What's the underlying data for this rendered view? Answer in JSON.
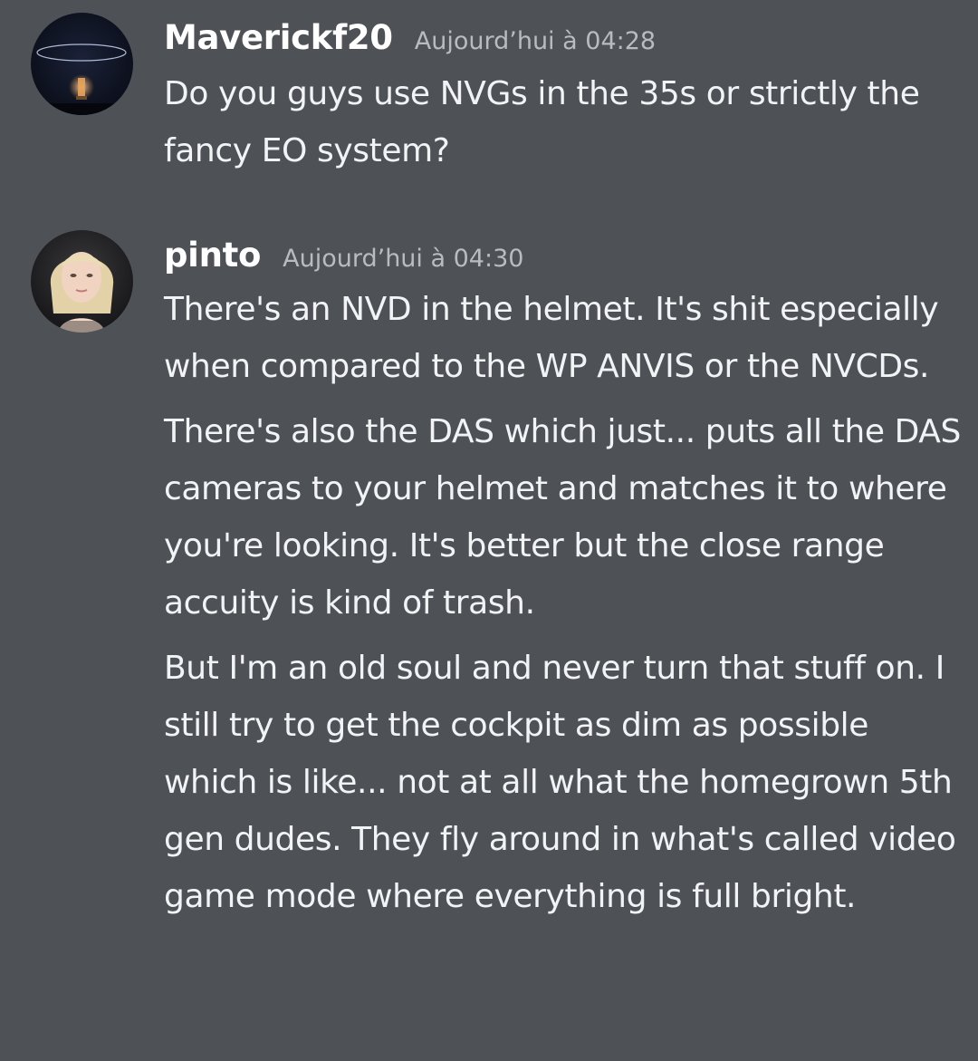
{
  "messages": [
    {
      "username": "Maverickf20",
      "timestamp": "Aujourd’hui à 04:28",
      "paragraphs": [
        "Do you guys use NVGs in the 35s or strictly the fancy EO system?"
      ]
    },
    {
      "username": "pinto",
      "timestamp": "Aujourd’hui à 04:30",
      "paragraphs": [
        "There's an NVD in the helmet. It's shit especially when compared to the WP ANVIS or the NVCDs.",
        "There's also the DAS which just... puts all the DAS cameras to your helmet and matches it to where you're looking. It's better but the close range accuity is kind of trash.",
        "But I'm an old soul and never turn that stuff on. I still try to get the cockpit as dim as possible which is like... not at all what the homegrown 5th gen dudes. They fly around in what's called video game mode where everything is full bright."
      ]
    }
  ],
  "colors": {
    "background": "#4e5257",
    "username": "#ffffff",
    "timestamp": "#b8bbbf",
    "text": "#f2f3f5"
  }
}
